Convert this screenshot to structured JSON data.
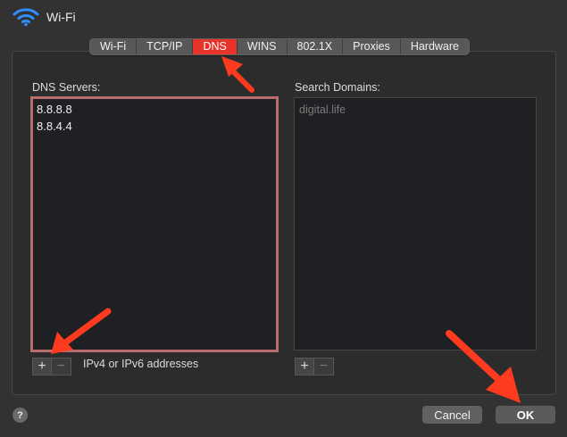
{
  "window": {
    "title": "Wi-Fi"
  },
  "tabs": [
    "Wi-Fi",
    "TCP/IP",
    "DNS",
    "WINS",
    "802.1X",
    "Proxies",
    "Hardware"
  ],
  "active_tab": "DNS",
  "dns": {
    "label": "DNS Servers:",
    "servers": [
      "8.8.8.8",
      "8.8.4.4"
    ],
    "add_label": "+",
    "remove_label": "−",
    "hint": "IPv4 or IPv6 addresses"
  },
  "search": {
    "label": "Search Domains:",
    "placeholder": "digital.life",
    "add_label": "+",
    "remove_label": "−"
  },
  "footer": {
    "help_label": "?",
    "cancel_label": "Cancel",
    "ok_label": "OK"
  },
  "colors": {
    "active_tab": "#e8332b",
    "annotation_arrow": "#ff3b1f",
    "highlight_border": "#b96e6e"
  },
  "icons": {
    "header": "wifi-icon",
    "annotation": "red-arrow-icon"
  }
}
